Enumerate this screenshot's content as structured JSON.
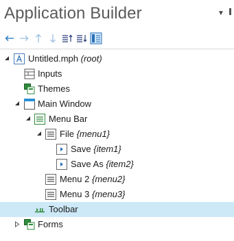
{
  "panel": {
    "title": "Application Builder"
  },
  "colors": {
    "accent": "#1e73be",
    "selection": "#cde8f7"
  },
  "toolbar": {
    "buttons": [
      {
        "name": "back",
        "icon": "arrow-left-icon"
      },
      {
        "name": "forward",
        "icon": "arrow-right-icon"
      },
      {
        "name": "move-up",
        "icon": "arrow-up-icon"
      },
      {
        "name": "move-down",
        "icon": "arrow-down-icon"
      },
      {
        "name": "sort-up",
        "icon": "sort-up-icon"
      },
      {
        "name": "sort-down",
        "icon": "sort-down-icon"
      },
      {
        "name": "layout",
        "icon": "layout-icon"
      }
    ]
  },
  "tree": {
    "root": {
      "label": "Untitled.mph",
      "tag": "(root)"
    },
    "inputs": {
      "label": "Inputs"
    },
    "themes": {
      "label": "Themes"
    },
    "main_window": {
      "label": "Main Window"
    },
    "menu_bar": {
      "label": "Menu Bar"
    },
    "file": {
      "label": "File",
      "tag": "{menu1}"
    },
    "save": {
      "label": "Save",
      "tag": "{item1}"
    },
    "save_as": {
      "label": "Save As",
      "tag": "{item2}"
    },
    "menu2": {
      "label": "Menu 2",
      "tag": "{menu2}"
    },
    "menu3": {
      "label": "Menu 3",
      "tag": "{menu3}"
    },
    "toolbar": {
      "label": "Toolbar"
    },
    "forms": {
      "label": "Forms"
    }
  }
}
